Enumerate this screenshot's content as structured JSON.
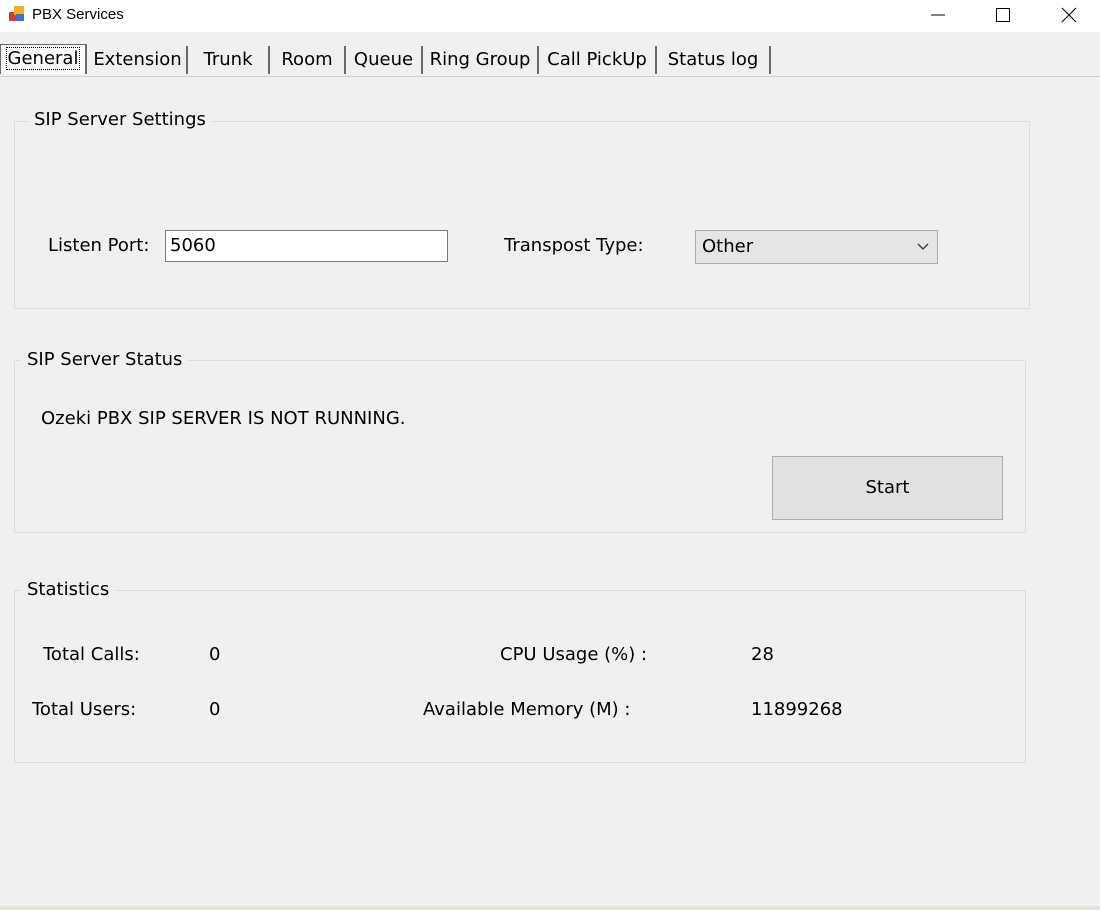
{
  "window": {
    "title": "PBX Services"
  },
  "tabs": [
    {
      "label": "General"
    },
    {
      "label": "Extension"
    },
    {
      "label": "Trunk"
    },
    {
      "label": "Room"
    },
    {
      "label": "Queue"
    },
    {
      "label": "Ring Group"
    },
    {
      "label": "Call PickUp"
    },
    {
      "label": "Status log"
    }
  ],
  "settings": {
    "legend": "SIP Server Settings",
    "listen_port_label": "Listen Port:",
    "listen_port_value": "5060",
    "transport_label": "Transpost Type:",
    "transport_value": "Other"
  },
  "status": {
    "legend": "SIP Server Status",
    "message": "Ozeki PBX SIP SERVER IS NOT RUNNING.",
    "start_label": "Start"
  },
  "statistics": {
    "legend": "Statistics",
    "total_calls_label": "Total Calls:",
    "total_calls_value": "0",
    "total_users_label": "Total Users:",
    "total_users_value": "0",
    "cpu_label": "CPU Usage (%) :",
    "cpu_value": "28",
    "memory_label": "Available Memory (M) :",
    "memory_value": "11899268"
  }
}
